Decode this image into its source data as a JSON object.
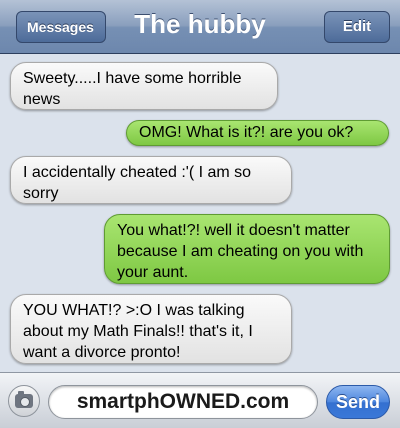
{
  "navbar": {
    "back_label": "Messages",
    "title": "The hubby",
    "edit_label": "Edit"
  },
  "messages": [
    {
      "from": "them",
      "text": "Sweety.....I have some horrible news"
    },
    {
      "from": "me",
      "text": "OMG! What is it?! are you ok?"
    },
    {
      "from": "them",
      "text": "I accidentally cheated :'( I am so sorry"
    },
    {
      "from": "me",
      "text": "You what!?! well it doesn't matter because I am cheating on you with your aunt."
    },
    {
      "from": "them",
      "text": "YOU WHAT!? >:O I was talking about my Math Finals!! that's it, I want a divorce pronto!"
    }
  ],
  "composer": {
    "field_text": "smartphOWNED.com",
    "send_label": "Send",
    "camera_icon": "camera-icon"
  },
  "colors": {
    "incoming_bubble": "#e9e9e9",
    "outgoing_bubble": "#8fd655",
    "navbar": "#7a93b8",
    "send_button": "#3a78d8"
  }
}
